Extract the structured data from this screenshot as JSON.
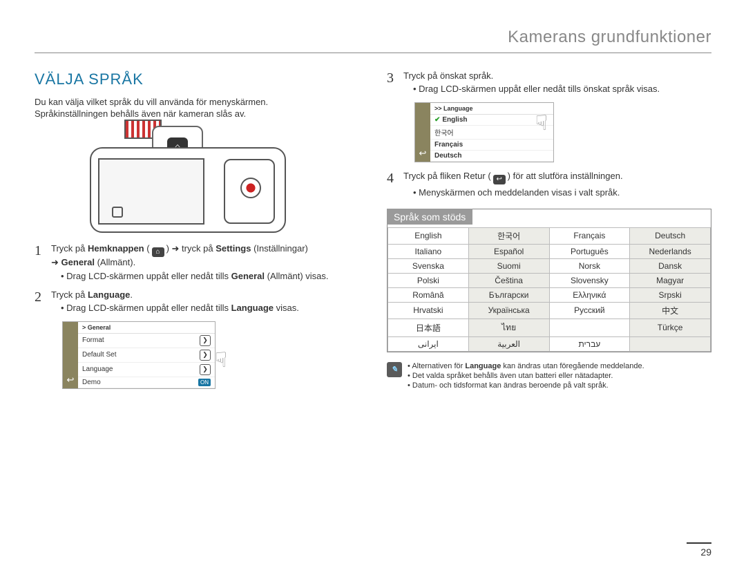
{
  "header": {
    "title": "Kamerans grundfunktioner"
  },
  "page_number": "29",
  "section": {
    "title": "VÄLJA SPRÅK",
    "intro_line1": "Du kan välja vilket språk du vill använda för menyskärmen.",
    "intro_line2": "Språkinställningen behålls även när kameran slås av."
  },
  "icons": {
    "home": "⌂",
    "return": "↩",
    "arrow": "➜",
    "chevron": "❯",
    "hand": "☟",
    "note": "✎",
    "check": "✔"
  },
  "steps_left": [
    {
      "num": "1",
      "parts": {
        "p1": "Tryck på ",
        "b1": "Hemknappen",
        "p2": " (",
        "p3": ") ",
        "p4": " tryck på ",
        "b2": "Settings",
        "p5": " (Inställningar) ",
        "p6": " ",
        "b3": "General",
        "p7": " (Allmänt).",
        "bullet": "Drag LCD-skärmen uppåt eller nedåt tills ",
        "bullet_bold": "General",
        "bullet_tail": " (Allmänt) visas."
      }
    },
    {
      "num": "2",
      "parts": {
        "p1": "Tryck på ",
        "b1": "Language",
        "p2": ".",
        "bullet": "Drag LCD-skärmen uppåt eller nedåt tills ",
        "bullet_bold": "Language",
        "bullet_tail": " visas."
      }
    }
  ],
  "general_menu": {
    "header": "> General",
    "items": [
      "Format",
      "Default Set",
      "Language",
      "Demo"
    ],
    "on_label": "ON"
  },
  "steps_right": [
    {
      "num": "3",
      "parts": {
        "p1": "Tryck på önskat språk.",
        "bullet": "Drag LCD-skärmen uppåt eller nedåt tills önskat språk visas."
      }
    },
    {
      "num": "4",
      "parts": {
        "p1": "Tryck på fliken Retur (",
        "p2": ") för att slutföra inställningen.",
        "bullet": "Menyskärmen och meddelanden visas i valt språk."
      }
    }
  ],
  "language_menu": {
    "header": ">> Language",
    "items": [
      "English",
      "한국어",
      "Français",
      "Deutsch"
    ]
  },
  "supported_languages": {
    "title": "Språk som stöds",
    "rows": [
      [
        "English",
        "한국어",
        "Français",
        "Deutsch"
      ],
      [
        "Italiano",
        "Español",
        "Português",
        "Nederlands"
      ],
      [
        "Svenska",
        "Suomi",
        "Norsk",
        "Dansk"
      ],
      [
        "Polski",
        "Čeština",
        "Slovensky",
        "Magyar"
      ],
      [
        "Română",
        "Български",
        "Ελληνικά",
        "Srpski"
      ],
      [
        "Hrvatski",
        "Українська",
        "Русский",
        "中文"
      ],
      [
        "日本語",
        "ไทย",
        "",
        "Türkçe"
      ],
      [
        "ایرانی",
        "العربية",
        "עברית",
        ""
      ]
    ]
  },
  "notes": [
    {
      "pre": "Alternativen för ",
      "bold": "Language",
      "post": " kan ändras utan föregående meddelande."
    },
    {
      "text": "Det valda språket behålls även utan batteri eller nätadapter."
    },
    {
      "text": "Datum- och tidsformat kan ändras beroende på valt språk."
    }
  ]
}
